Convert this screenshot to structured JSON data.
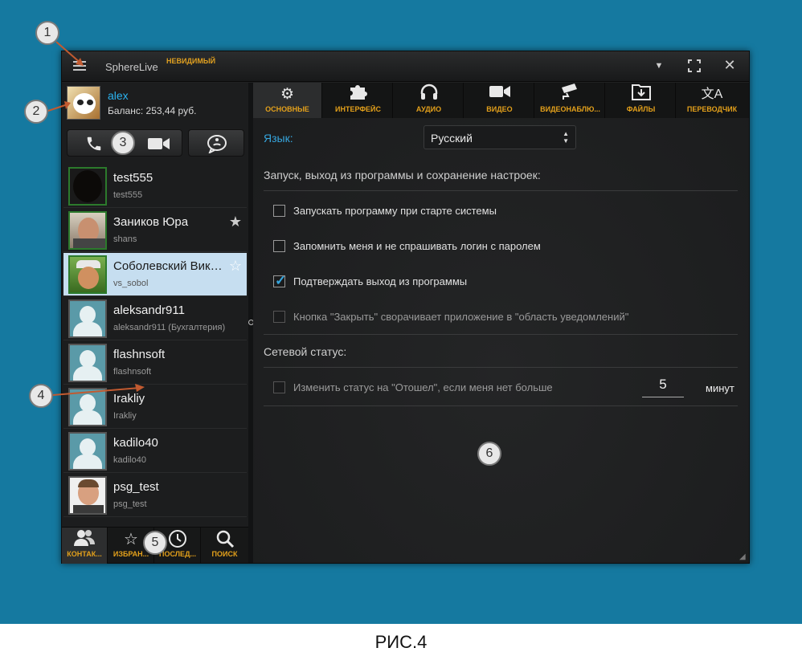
{
  "window": {
    "app_name": "SphereLive",
    "status": "НЕВИДИМЫЙ"
  },
  "profile": {
    "name": "alex",
    "balance": "Баланс: 253,44 руб."
  },
  "contacts": [
    {
      "name": "test555",
      "sub": "test555",
      "starred": false
    },
    {
      "name": "Заников Юра",
      "sub": "shans",
      "starred": true
    },
    {
      "name": "Соболевский Вик…",
      "sub": "vs_sobol",
      "starred": false,
      "selected": true
    },
    {
      "name": "aleksandr911",
      "sub": "aleksandr911 (Бухгалтерия)",
      "starred": false
    },
    {
      "name": "flashnsoft",
      "sub": "flashnsoft",
      "starred": false
    },
    {
      "name": "Irakliy",
      "sub": "Irakliy",
      "starred": false
    },
    {
      "name": "kadilo40",
      "sub": "kadilo40",
      "starred": false
    },
    {
      "name": "psg_test",
      "sub": "psg_test",
      "starred": false
    }
  ],
  "bottom_tabs": [
    "КОНТАК...",
    "ИЗБРАН...",
    "ПОСЛЕД...",
    "ПОИСК"
  ],
  "top_tabs": [
    "ОСНОВНЫЕ",
    "ИНТЕРФЕЙС",
    "АУДИО",
    "ВИДЕО",
    "ВИДЕОНАБЛЮ...",
    "ФАЙЛЫ",
    "ПЕРЕВОДЧИК"
  ],
  "settings": {
    "language_label": "Язык:",
    "language_value": "Русский",
    "startup_section": "Запуск, выход из программы и сохранение настроек:",
    "options": [
      {
        "text": "Запускать программу при старте системы",
        "checked": false,
        "disabled": false
      },
      {
        "text": "Запомнить меня и не спрашивать логин с паролем",
        "checked": false,
        "disabled": false
      },
      {
        "text": "Подтверждать выход из программы",
        "checked": true,
        "disabled": false
      },
      {
        "text": "Кнопка \"Закрыть\" сворачивает приложение в \"область уведомлений\"",
        "checked": false,
        "disabled": true
      }
    ],
    "network_section": "Сетевой статус:",
    "away_option": "Изменить статус на \"Отошел\", если меня нет больше",
    "away_minutes": "5",
    "minutes_label": "минут"
  },
  "callouts": [
    "1",
    "2",
    "3",
    "4",
    "5",
    "6"
  ],
  "caption": "РИС.4",
  "colors": {
    "background": "#1579a0",
    "accent_orange": "#e3a01b",
    "accent_blue": "#36a6de",
    "selected_row": "#c6def0"
  }
}
